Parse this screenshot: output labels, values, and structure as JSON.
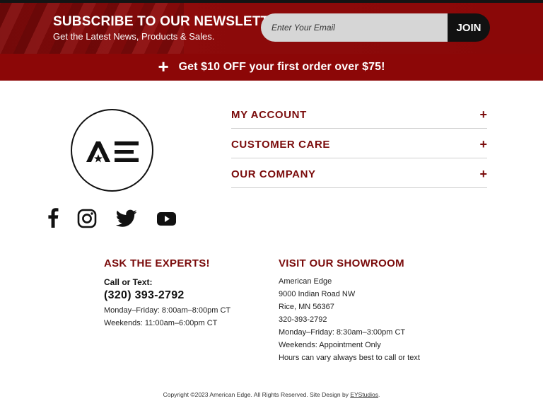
{
  "newsletter": {
    "title": "SUBSCRIBE TO OUR NEWSLETTER",
    "subtitle": "Get the Latest News, Products & Sales.",
    "email_placeholder": "Enter Your Email",
    "join_label": "JOIN"
  },
  "promo": {
    "icon": "plus-icon",
    "text": "Get $10 OFF your first order over $75!"
  },
  "logo": {
    "text": "AE"
  },
  "accordion": {
    "items": [
      {
        "label": "MY ACCOUNT",
        "icon": "plus"
      },
      {
        "label": "CUSTOMER CARE",
        "icon": "plus"
      },
      {
        "label": "OUR COMPANY",
        "icon": "plus"
      }
    ]
  },
  "social": [
    "facebook-icon",
    "instagram-icon",
    "twitter-icon",
    "youtube-icon"
  ],
  "experts": {
    "title": "ASK THE EXPERTS!",
    "call_label": "Call or Text:",
    "phone": "(320) 393-2792",
    "hours_weekday": "Monday–Friday: 8:00am–8:00pm CT",
    "hours_weekend": "Weekends: 11:00am–6:00pm CT"
  },
  "showroom": {
    "title": "VISIT OUR SHOWROOM",
    "lines": [
      "American Edge",
      "9000 Indian Road NW",
      "Rice, MN 56367",
      "320-393-2792",
      "Monday–Friday: 8:30am–3:00pm CT",
      "Weekends: Appointment Only",
      "Hours can vary always best to call or text"
    ]
  },
  "footer": {
    "copyright": "Copyright ©2023 American Edge. All Rights Reserved. Site Design by ",
    "designer": "EYStudios",
    "end": "."
  },
  "colors": {
    "brand_red": "#8c0707",
    "heading_red": "#7a0b0b",
    "dark": "#111111"
  }
}
